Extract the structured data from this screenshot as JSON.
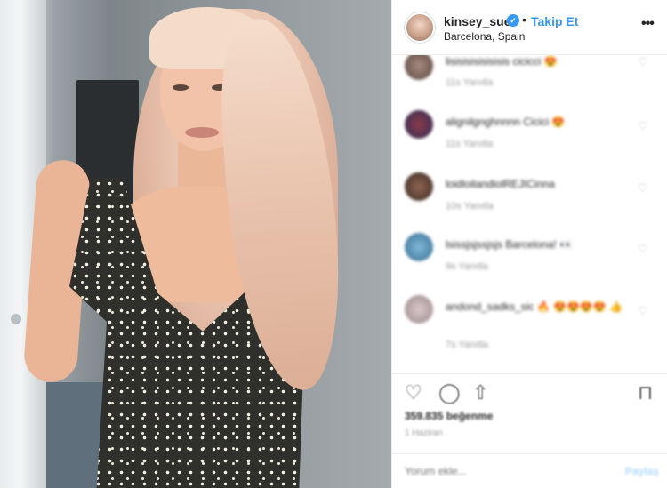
{
  "header": {
    "username": "kinsey_sue",
    "verified_badge": "✓",
    "separator": "•",
    "follow_label": "Takip Et",
    "location": "Barcelona, Spain",
    "more_icon": "more-horizontal-icon"
  },
  "comments": [
    {
      "text": "lisisisisisisisis cicicci 😍",
      "meta": "11s   Yanıtla"
    },
    {
      "text": "alignilgnghnnnn Cicici 😍",
      "meta": "11s   Yanıtla"
    },
    {
      "text": "loidloilandiolREJICinna",
      "meta": "10s   Yanıtla"
    },
    {
      "text": "lsissjsjssjsjs Barcelona! 👀",
      "meta": "9s   Yanıtla"
    },
    {
      "text": "andond_sadks_sic 🔥 😍😍😍😍 👍",
      "meta": "7s   Yanıtla"
    }
  ],
  "actions": {
    "like_icon": "heart-icon",
    "comment_icon": "comment-icon",
    "share_icon": "share-icon",
    "save_icon": "bookmark-icon"
  },
  "likes": "359.835 beğenme",
  "date": "1 Haziran",
  "comment_bar": {
    "placeholder": "Yorum ekle...",
    "post_label": "Paylaş"
  },
  "colors": {
    "accent": "#3897f0",
    "text": "#262626",
    "muted": "#999999"
  }
}
